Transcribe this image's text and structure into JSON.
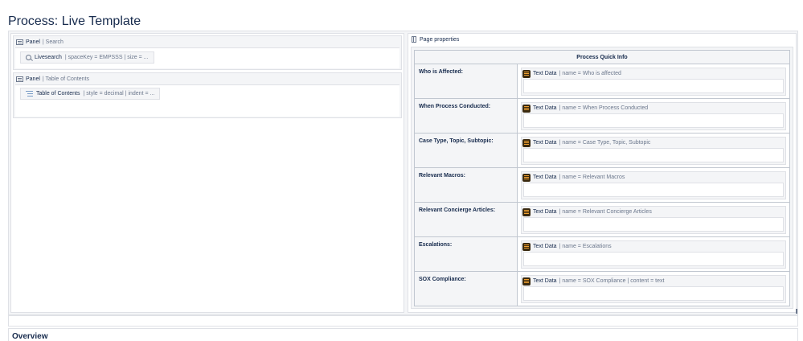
{
  "page": {
    "title": "Process: Live Template"
  },
  "left": {
    "panel_search": {
      "macro": "Panel",
      "param": "| Search",
      "chip_name": "Livesearch",
      "chip_params": "| spaceKey = EMPSSS | size = ..."
    },
    "panel_toc": {
      "macro": "Panel",
      "param": "| Table of Contents",
      "chip_name": "Table of Contents",
      "chip_params": "| style = decimal | indent = ..."
    }
  },
  "right": {
    "page_properties": "Page properties",
    "table_header": "Process Quick Info",
    "rows": [
      {
        "label": "Who is Affected:",
        "macro": "Text Data",
        "params": "| name = Who is affected"
      },
      {
        "label": "When Process Conducted:",
        "macro": "Text Data",
        "params": "| name = When Process Conducted"
      },
      {
        "label": "Case Type, Topic, Subtopic:",
        "macro": "Text Data",
        "params": "| name = Case Type, Topic, Subtopic"
      },
      {
        "label": "Relevant Macros:",
        "macro": "Text Data",
        "params": "| name = Relevant Macros"
      },
      {
        "label": "Relevant Concierge Articles:",
        "macro": "Text Data",
        "params": "| name = Relevant Concierge Articles"
      },
      {
        "label": "Escalations:",
        "macro": "Text Data",
        "params": "| name = Escalations"
      },
      {
        "label": "SOX Compliance:",
        "macro": "Text Data",
        "params": "| name = SOX Compliance | content = text"
      }
    ]
  },
  "overview": {
    "heading": "Overview"
  },
  "icons": [
    "panel-icon",
    "search-icon",
    "toc-icon",
    "page-properties-icon",
    "text-data-icon"
  ]
}
